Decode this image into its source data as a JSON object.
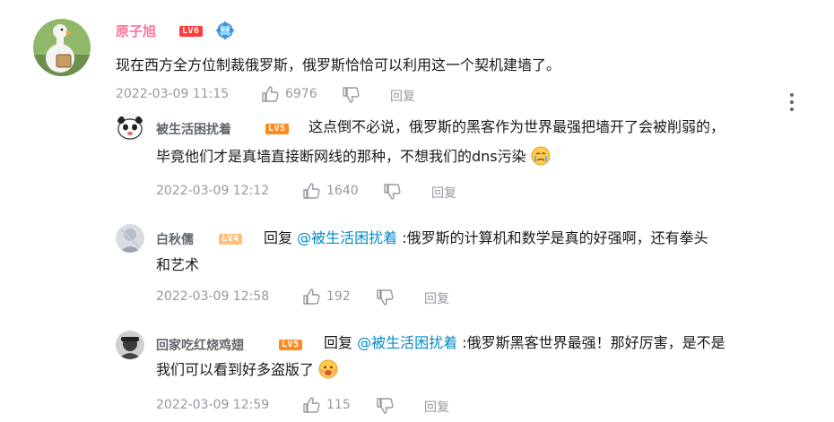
{
  "main_comment": {
    "username": "原子旭",
    "level": "LV6",
    "text": "现在西方全方位制裁俄罗斯，俄罗斯恰恰可以利用这一个契机建墙了。",
    "time": "2022-03-09 11:15",
    "likes": "6976",
    "reply_label": "回复"
  },
  "replies": [
    {
      "username": "被生活困扰着",
      "level": "LV5",
      "text_line1": "这点倒不必说，俄罗斯的黑客作为世界最强把墙开了会被削弱的，",
      "text_line2": "毕竟他们才是真墙直接断网线的那种，不想我们的dns污染",
      "time": "2022-03-09 12:12",
      "likes": "1640",
      "reply_label": "回复"
    },
    {
      "username": "白秋儒",
      "level": "LV4",
      "reply_prefix": "回复",
      "mention": "@被生活困扰着",
      "text_line1": ":俄罗斯的计算机和数学是真的好强啊，还有拳头",
      "text_line2": "和艺术",
      "time": "2022-03-09 12:58",
      "likes": "192",
      "reply_label": "回复"
    },
    {
      "username": "回家吃红烧鸡翅",
      "level": "LV5",
      "reply_prefix": "回复",
      "mention": "@被生活困扰着",
      "text_line1": ":俄罗斯黑客世界最强！那好厉害，是不是",
      "text_line2": "我们可以看到好多盗版了",
      "time": "2022-03-09 12:59",
      "likes": "115",
      "reply_label": "回复"
    }
  ],
  "icons": {
    "like": "thumbs-up-icon",
    "dislike": "thumbs-down-icon",
    "more": "vertical-ellipsis-icon"
  },
  "colors": {
    "main_username": "#fb7299",
    "mention": "#008ac5",
    "meta": "#9499a0"
  }
}
